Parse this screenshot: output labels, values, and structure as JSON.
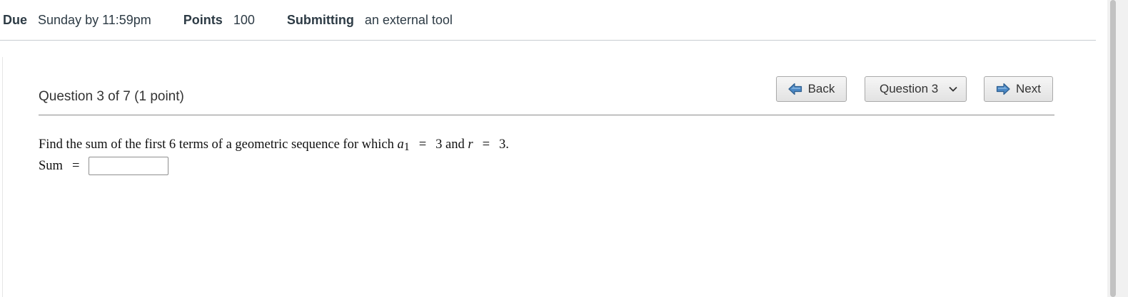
{
  "details": {
    "due_label": "Due",
    "due_value": "Sunday by 11:59pm",
    "points_label": "Points",
    "points_value": "100",
    "submitting_label": "Submitting",
    "submitting_value": "an external tool"
  },
  "question": {
    "title": "Question 3 of 7 (1 point)",
    "back_label": "Back",
    "select_value": "Question 3",
    "next_label": "Next",
    "prompt_text": "Find the sum of the first 6 terms of a geometric sequence for which ",
    "var_a": "a",
    "sub_1": "1",
    "equals": "=",
    "value_a1": "3",
    "and_text": " and ",
    "var_r": "r",
    "value_r": "3.",
    "sum_label": "Sum",
    "answer_value": ""
  },
  "colors": {
    "text": "#2d3b45",
    "divider": "#c7cdd1",
    "button_border": "#a9a9a9",
    "arrow_fill": "#4a87c4"
  },
  "icons": {
    "back": "left-arrow-icon",
    "next": "right-arrow-icon",
    "select": "chevron-down-icon"
  }
}
